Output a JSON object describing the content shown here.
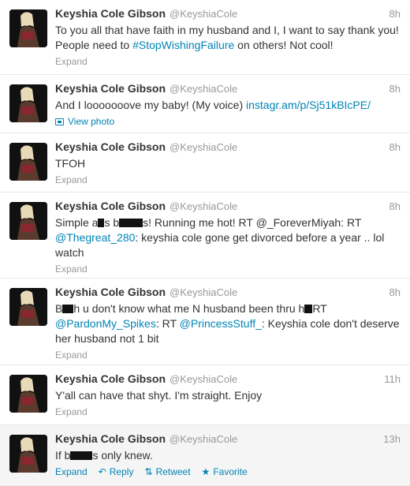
{
  "colors": {
    "link": "#0084b4",
    "muted": "#999999",
    "text": "#333333",
    "hover_bg": "#f5f5f5"
  },
  "tweets": [
    {
      "name": "Keyshia Cole Gibson",
      "handle": "@KeyshiaCole",
      "time": "8h",
      "t1": "To you all that have faith in my husband and I, I want to say thank you! People need to ",
      "hashtag": "#StopWishingFailure",
      "t2": " on others! Not cool!",
      "expand": "Expand"
    },
    {
      "name": "Keyshia Cole Gibson",
      "handle": "@KeyshiaCole",
      "time": "8h",
      "t1": "And I looooooove my baby! (My voice) ",
      "link": "instagr.am/p/Sj51kBIcPE/",
      "view_photo": "View photo",
      "photo_icon": "photo-icon"
    },
    {
      "name": "Keyshia Cole Gibson",
      "handle": "@KeyshiaCole",
      "time": "8h",
      "t1": "TFOH",
      "expand": "Expand"
    },
    {
      "name": "Keyshia Cole Gibson",
      "handle": "@KeyshiaCole",
      "time": "8h",
      "t1": "Simple a",
      "t2": "s b",
      "t3": "s! Running me hot! RT @_ForeverMiyah: RT ",
      "mention": "@Thegreat_280",
      "t4": ": keyshia cole gone get divorced before a year .. lol watch",
      "expand": "Expand"
    },
    {
      "name": "Keyshia Cole Gibson",
      "handle": "@KeyshiaCole",
      "time": "8h",
      "t1": "B",
      "t2": "h u don't know what me N husband been thru h",
      "t3": "RT ",
      "mention1": "@PardonMy_Spikes",
      "t4": ": RT ",
      "mention2": "@PrincessStuff_",
      "t5": ": Keyshia cole don't deserve her husband not 1 bit",
      "expand": "Expand"
    },
    {
      "name": "Keyshia Cole Gibson",
      "handle": "@KeyshiaCole",
      "time": "11h",
      "t1": "Y'all can have that shyt. I'm straight. Enjoy",
      "expand": "Expand"
    },
    {
      "name": "Keyshia Cole Gibson",
      "handle": "@KeyshiaCole",
      "time": "13h",
      "t1": "If b",
      "t2": "s only knew.",
      "expand": "Expand",
      "reply": "Reply",
      "retweet": "Retweet",
      "favorite": "Favorite",
      "reply_icon": "reply-icon",
      "retweet_icon": "retweet-icon",
      "favorite_icon": "star-icon"
    }
  ]
}
